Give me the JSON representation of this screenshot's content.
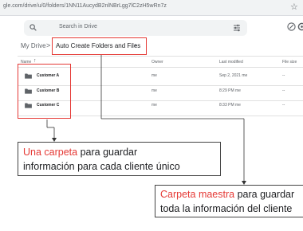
{
  "browser": {
    "url": "gle.com/drive/u/0/folders/1NN11AucydB2nlNBrLgg7lC2zH5wRn7z"
  },
  "search": {
    "placeholder": "Search in Drive"
  },
  "breadcrumb": {
    "root": "My Drive",
    "separator": ">",
    "current": "Auto Create Folders and Files",
    "caret": "▾"
  },
  "table": {
    "columns": {
      "name": "Name",
      "sort": "↑",
      "owner": "Owner",
      "modified": "Last modified",
      "size": "File size"
    },
    "rows": [
      {
        "name": "Customer A",
        "owner": "me",
        "modified": "Sep 2, 2021",
        "modified_by": "me",
        "size": "--"
      },
      {
        "name": "Customer B",
        "owner": "me",
        "modified": "8:29 PM",
        "modified_by": "me",
        "size": "--"
      },
      {
        "name": "Customer C",
        "owner": "me",
        "modified": "8:33 PM",
        "modified_by": "me",
        "size": "--"
      }
    ]
  },
  "callouts": {
    "folder": {
      "highlight": "Una carpeta",
      "rest_line1": " para guardar",
      "line2": "información para cada cliente único"
    },
    "master": {
      "highlight": "Carpeta maestra",
      "rest_line1": " para guardar",
      "line2": "toda la información del cliente"
    }
  },
  "colors": {
    "accent_red": "#e53935",
    "folder_gray": "#5f6368",
    "search_bg": "#f1f3f4"
  },
  "icons": [
    "star-icon",
    "search-icon",
    "tune-icon",
    "status-icon",
    "settings-icon",
    "folder-icon"
  ]
}
